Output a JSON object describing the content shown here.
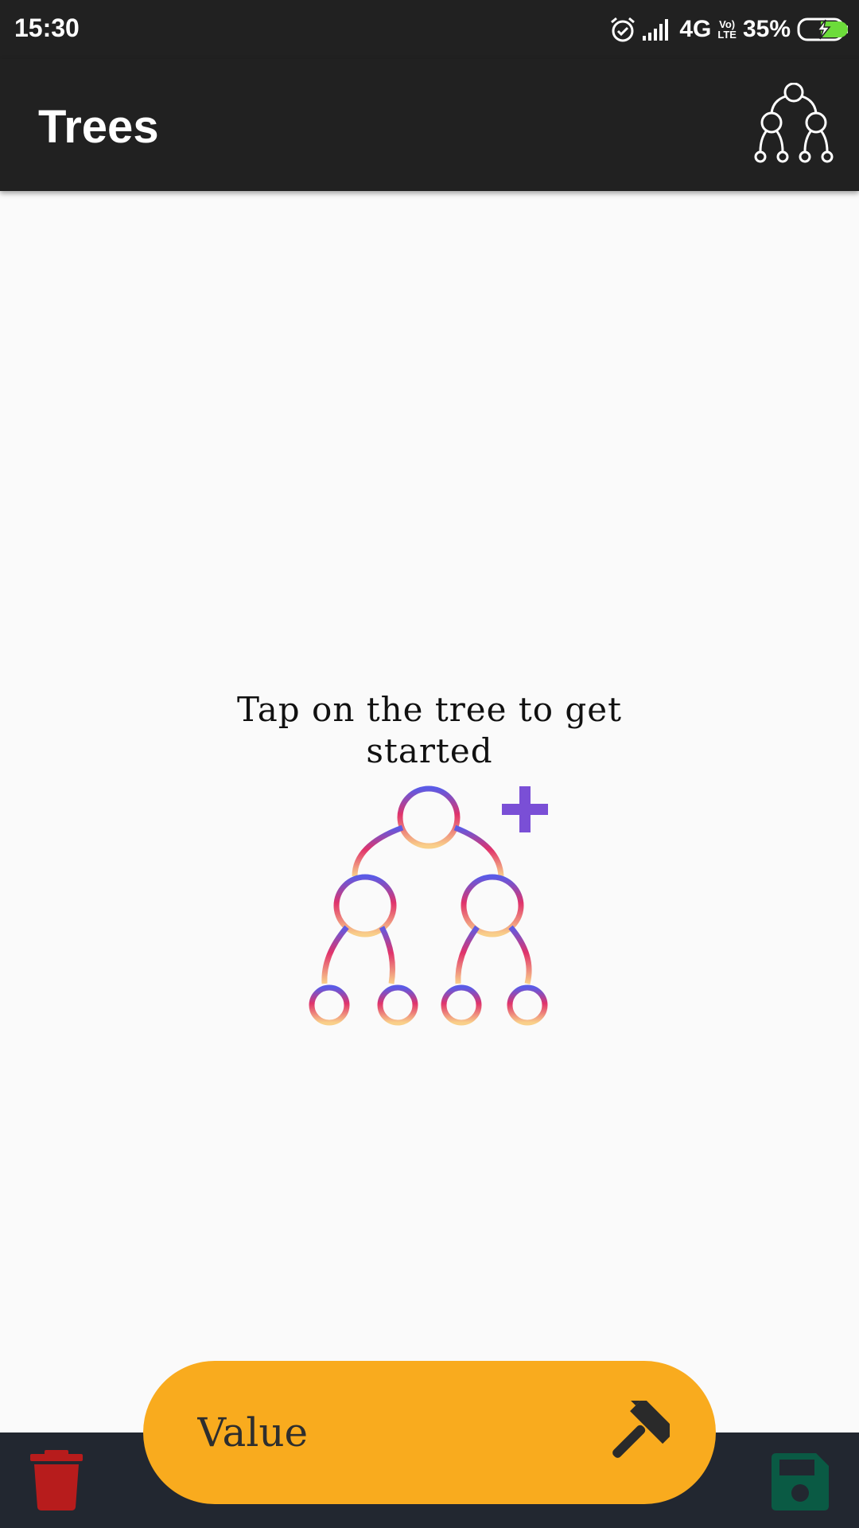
{
  "status_bar": {
    "time": "15:30",
    "network": "4G",
    "volte_top": "Vo)",
    "volte_bottom": "LTE",
    "battery": "35%",
    "icons": [
      "alarm-icon",
      "signal-icon",
      "battery-charging-icon"
    ]
  },
  "app_bar": {
    "title": "Trees",
    "action_icon": "binary-tree-icon"
  },
  "main": {
    "empty_message": "Tap on the tree to get started",
    "illustration_icon": "add-tree-icon",
    "illustration_colors": {
      "top": "#5b5be6",
      "middle": "#e0336b",
      "bottom": "#f9d08a",
      "plus": "#7a4fd6"
    }
  },
  "bottom_bar": {
    "background": "#222730",
    "delete_icon": "trash-icon",
    "delete_color": "#b71c1c",
    "save_icon": "floppy-disk-icon",
    "save_color": "#0a5a44",
    "value_input": {
      "placeholder": "Value",
      "value": "",
      "background": "#f9ab1e",
      "action_icon": "hammer-icon"
    }
  }
}
